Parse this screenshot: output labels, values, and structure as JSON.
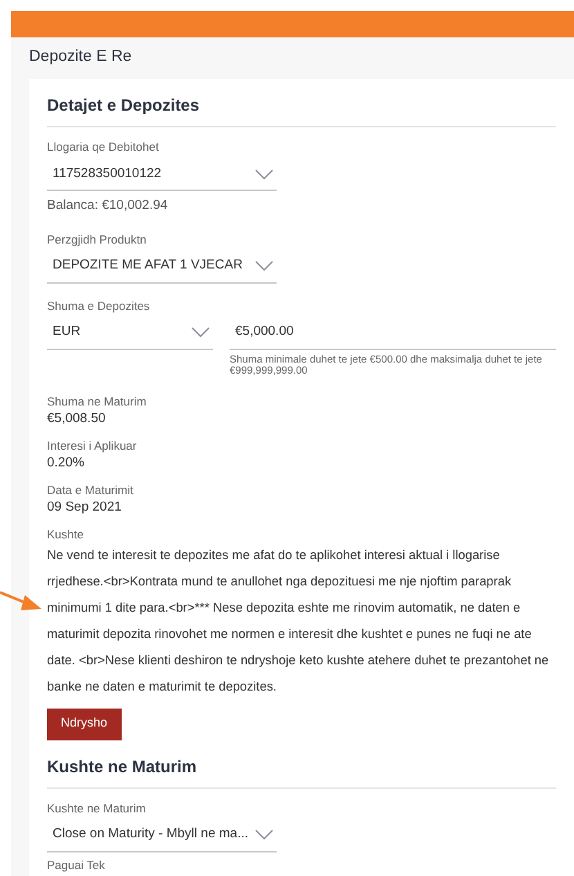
{
  "page_title": "Depozite E Re",
  "sections": [
    {
      "title": "Detajet e Depozites"
    },
    {
      "title": "Kushte ne Maturim"
    }
  ],
  "account": {
    "label": "Llogaria qe Debitohet",
    "value": "117528350010122",
    "balance": "Balanca: €10,002.94"
  },
  "product": {
    "label": "Perzgjidh Produktn",
    "value": "DEPOZITE ME AFAT 1 VJECAR"
  },
  "amount": {
    "label": "Shuma e Depozites",
    "currency": "EUR",
    "value": "€5,000.00",
    "hint": "Shuma minimale duhet te jete €500.00 dhe maksimalja duhet te jete €999,999,999.00"
  },
  "details": [
    {
      "label": "Shuma ne Maturim",
      "value": "€5,008.50"
    },
    {
      "label": "Interesi i Aplikuar",
      "value": "0.20%"
    },
    {
      "label": "Data e Maturimit",
      "value": "09 Sep 2021"
    }
  ],
  "terms": {
    "label": "Kushte",
    "text": "Ne vend te interesit te depozites me afat do te aplikohet interesi aktual i llogarise rrjedhese.<br>Kontrata mund te anullohet nga depozituesi me nje njoftim paraprak minimumi 1 dite para.<br>*** Nese depozita eshte me rinovim automatik, ne daten e maturimit depozita rinovohet me normen e interesit dhe kushtet e punes ne fuqi ne ate date. <br>Nese klienti deshiron te ndryshoje keto kushte atehere duhet te prezantohet ne banke ne daten e maturimit te depozites.",
    "button": "Ndrysho"
  },
  "maturity": {
    "label": "Kushte ne Maturim",
    "value": "Close on Maturity - Mbyll ne ma...",
    "next_label": "Paguai Tek"
  }
}
